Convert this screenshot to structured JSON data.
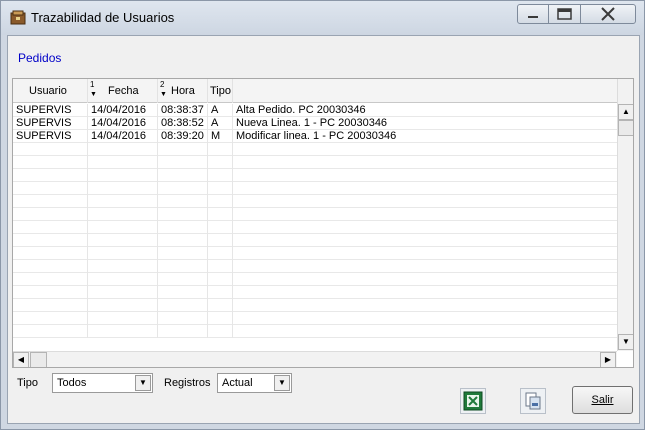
{
  "window": {
    "title": "Trazabilidad de Usuarios"
  },
  "section_label": "Pedidos",
  "grid": {
    "columns": [
      {
        "label": "Usuario",
        "sort_order": ""
      },
      {
        "label": "Fecha",
        "sort_order": "1"
      },
      {
        "label": "Hora",
        "sort_order": "2"
      },
      {
        "label": "Tipo",
        "sort_order": ""
      },
      {
        "label": "",
        "sort_order": ""
      }
    ],
    "rows": [
      {
        "usuario": "SUPERVIS",
        "fecha": "14/04/2016",
        "hora": "08:38:37",
        "tipo": "A",
        "descripcion": "Alta Pedido.  PC 20030346"
      },
      {
        "usuario": "SUPERVIS",
        "fecha": "14/04/2016",
        "hora": "08:38:52",
        "tipo": "A",
        "descripcion": "Nueva Linea.  1 - PC 20030346"
      },
      {
        "usuario": "SUPERVIS",
        "fecha": "14/04/2016",
        "hora": "08:39:20",
        "tipo": "M",
        "descripcion": "Modificar linea.  1 - PC 20030346"
      }
    ],
    "empty_rows": 15
  },
  "filters": {
    "tipo_label": "Tipo",
    "tipo_value": "Todos",
    "registros_label": "Registros",
    "registros_value": "Actual"
  },
  "buttons": {
    "salir_label": "Salir",
    "excel_icon": "excel-icon",
    "print_icon": "print-preview-icon"
  }
}
